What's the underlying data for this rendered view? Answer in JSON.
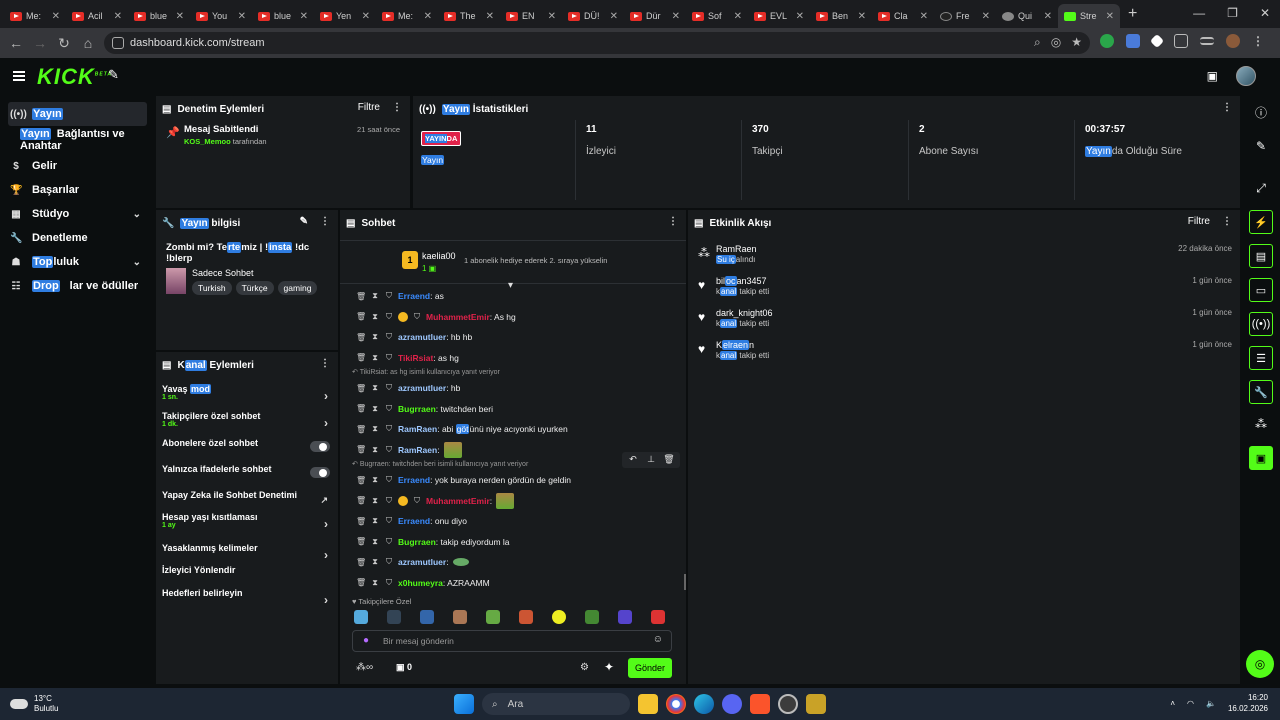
{
  "browser": {
    "tabs": [
      {
        "title": "Me:",
        "icon": "youtube"
      },
      {
        "title": "Acil",
        "icon": "youtube"
      },
      {
        "title": "blue",
        "icon": "youtube"
      },
      {
        "title": "You",
        "icon": "youtube"
      },
      {
        "title": "blue",
        "icon": "youtube"
      },
      {
        "title": "Yen",
        "icon": "youtube"
      },
      {
        "title": "Me:",
        "icon": "youtube"
      },
      {
        "title": "The",
        "icon": "youtube"
      },
      {
        "title": "EN",
        "icon": "youtube"
      },
      {
        "title": "DÜ!",
        "icon": "youtube"
      },
      {
        "title": "Dür",
        "icon": "youtube"
      },
      {
        "title": "Sof",
        "icon": "youtube"
      },
      {
        "title": "EVL",
        "icon": "youtube"
      },
      {
        "title": "Ben",
        "icon": "youtube"
      },
      {
        "title": "Cla",
        "icon": "youtube"
      },
      {
        "title": "Fre",
        "icon": "github"
      },
      {
        "title": "Qui",
        "icon": "quizlet"
      },
      {
        "title": "Stre",
        "icon": "kick",
        "active": true
      }
    ],
    "url": "dashboard.kick.com/stream"
  },
  "kick": {
    "logo": "KICK",
    "logo_sup": "BETA"
  },
  "nav": {
    "items": [
      {
        "label_hl": "Yayın",
        "label": "",
        "icon": "broadcast-icon"
      },
      {
        "label_hl": "Yayın",
        "label": "Bağlantısı ve Anahtar",
        "icon": ""
      },
      {
        "label_hl": "",
        "label": "Gelir",
        "icon": "dollar-icon"
      },
      {
        "label_hl": "",
        "label": "Başarılar",
        "icon": "trophy-icon"
      },
      {
        "label_hl": "",
        "label": "Stüdyo",
        "icon": "studio-icon"
      },
      {
        "label_hl": "",
        "label": "Denetleme",
        "icon": "wrench-icon"
      },
      {
        "label_hl": "Top",
        "label": "luluk",
        "icon": "community-icon"
      },
      {
        "label_hl": "Drop",
        "label": "lar ve ödüller",
        "icon": "drops-icon"
      }
    ]
  },
  "mod_panel": {
    "title": "Denetim Eylemleri",
    "filter": "Filtre",
    "entry_title": "Mesaj Sabitlendi",
    "entry_time": "21 saat önce",
    "entry_user": "KOS_Memoo",
    "entry_suffix": "tarafından"
  },
  "stats_panel": {
    "title_hl": "Yayın",
    "title": " İstatistikleri",
    "live_badge_hl": "YAYIN",
    "live_badge": "DA",
    "live_sub": "Yayın",
    "stats": [
      {
        "value": "11",
        "label": "İzleyici"
      },
      {
        "value": "370",
        "label": "Takipçi"
      },
      {
        "value": "2",
        "label": "Abone Sayısı"
      },
      {
        "value": "00:37:57",
        "label_hl": "Yayın",
        "label": "da Olduğu Süre"
      }
    ]
  },
  "info_panel": {
    "title_hl": "Yayın",
    "title": " bilgisi",
    "stream_title_pre": "Zombi mi? Te",
    "stream_title_hl": "rte",
    "stream_title_mid": "miz | !",
    "stream_title_hl2": "insta",
    "stream_title_end": " !dc !blerp",
    "category": "Sadece Sohbet",
    "tags": [
      "Turkish",
      "Türkçe",
      "gaming"
    ]
  },
  "actions_panel": {
    "title_pre": "K",
    "title_hl": "anal",
    "title": " Eylemleri",
    "items": [
      {
        "label": "Yavaş ",
        "label_hl": "mod",
        "sub": "1 sn.",
        "control": "chevron"
      },
      {
        "label": "Takipçilere özel sohbet",
        "label_hl": "",
        "sub": "1 dk.",
        "control": "chevron"
      },
      {
        "label": "Abonelere özel sohbet",
        "label_hl": "",
        "sub": "",
        "control": "toggle"
      },
      {
        "label": "Yalnızca ifadelerle sohbet",
        "label_hl": "",
        "sub": "",
        "control": "toggle"
      },
      {
        "label": "Yapay Zeka ile Sohbet Denetimi",
        "label_hl": "",
        "sub": "",
        "control": "external"
      },
      {
        "label": "Hesap yaşı kısıtlaması",
        "label_hl": "",
        "sub": "1 ay",
        "control": "chevron"
      },
      {
        "label": "Yasaklanmış kelimeler",
        "label_hl": "",
        "sub": "",
        "control": "chevron"
      },
      {
        "label": "İzleyici Yönlendir",
        "label_hl": "",
        "sub": "",
        "control": "none"
      },
      {
        "label": "Hedefleri belirleyin",
        "label_hl": "",
        "sub": "",
        "control": "chevron"
      }
    ]
  },
  "chat_panel": {
    "title": "Sohbet",
    "pinned_user": "kaelia00",
    "pinned_text": "1 abonelik hediye ederek 2. sıraya yükselin",
    "messages": [
      {
        "user": "Erraend",
        "color": "#3a8bff",
        "text": ": as",
        "badge": false,
        "emote": false
      },
      {
        "user": "MuhammetEmir",
        "color": "#e0224a",
        "text": ": As hg",
        "badge": true,
        "emote": false
      },
      {
        "user": "azramutluer",
        "color": "#9ec8ff",
        "text": ": hb hb",
        "badge": false,
        "emote": false
      },
      {
        "user": "TikiRsiat",
        "color": "#e0224a",
        "text": ": as hg",
        "badge": false,
        "emote": false
      },
      {
        "reply": "TikiRsiat: as hg isimli kullanıcıya yanıt veriyor"
      },
      {
        "user": "azramutluer",
        "color": "#9ec8ff",
        "text": ": hb",
        "badge": false,
        "emote": false
      },
      {
        "user": "Bugrraen",
        "color": "#53fc18",
        "text": ": twitchden beri",
        "badge": false,
        "emote": false
      },
      {
        "user": "RamRaen",
        "color": "#9ec8ff",
        "text_pre": ": abi ",
        "text_hl": "göt",
        "text": "ünü niye acıyonki uyurken",
        "badge": false,
        "emote": false
      },
      {
        "user": "RamRaen",
        "color": "#9ec8ff",
        "text": ":",
        "badge": false,
        "emote": true
      },
      {
        "reply": "Bugrraen: twitchden beri isimli kullanıcıya yanıt veriyor"
      },
      {
        "user": "Erraend",
        "color": "#3a8bff",
        "text": ": yok buraya nerden gördün de geldin",
        "badge": false,
        "emote": false
      },
      {
        "user": "MuhammetEmir",
        "color": "#e0224a",
        "text": ":",
        "badge": true,
        "emote": true
      },
      {
        "user": "Erraend",
        "color": "#3a8bff",
        "text": ": onu diyo",
        "badge": false,
        "emote": false
      },
      {
        "user": "Bugrraen",
        "color": "#53fc18",
        "text": ": takip ediyordum la",
        "badge": false,
        "emote": false
      },
      {
        "user": "azramutluer",
        "color": "#9ec8ff",
        "text": ":",
        "badge": false,
        "emote": true
      },
      {
        "user": "x0humeyra",
        "color": "#53fc18",
        "text": ": AZRAAMM",
        "badge": false,
        "emote": false
      }
    ],
    "emotes_label": "Takipçilere Özel",
    "input_placeholder": "Bir mesaj gönderin",
    "count": "0",
    "send": "Gönder"
  },
  "feed_panel": {
    "title": "Etkinlik Akışı",
    "filter": "Filtre",
    "items": [
      {
        "name": "RamRaen",
        "name_hl": "",
        "name_end": "",
        "sub_hl": "Su iç",
        "sub": "alındı",
        "time": "22 dakika önce",
        "icon": "drop-icon"
      },
      {
        "name": "bil",
        "name_hl": "oc",
        "name_end": "an3457",
        "sub_pre": "k",
        "sub_hl": "anal",
        "sub": " takip etti",
        "time": "1 gün önce",
        "icon": "heart-icon"
      },
      {
        "name": "dark_knight06",
        "name_hl": "",
        "name_end": "",
        "sub_pre": "k",
        "sub_hl": "anal",
        "sub": " takip etti",
        "time": "1 gün önce",
        "icon": "heart-icon"
      },
      {
        "name": "K",
        "name_hl": "elraen",
        "name_end": "n",
        "sub_pre": "k",
        "sub_hl": "anal",
        "sub": " takip etti",
        "time": "1 gün önce",
        "icon": "heart-icon"
      }
    ]
  },
  "taskbar": {
    "temp": "13°C",
    "weather": "Bulutlu",
    "search": "Ara",
    "time": "16:20",
    "date": "16.02.2026"
  },
  "colors": {
    "accent": "#53fc18",
    "highlight": "#2f7de1",
    "live": "#e0224a"
  }
}
